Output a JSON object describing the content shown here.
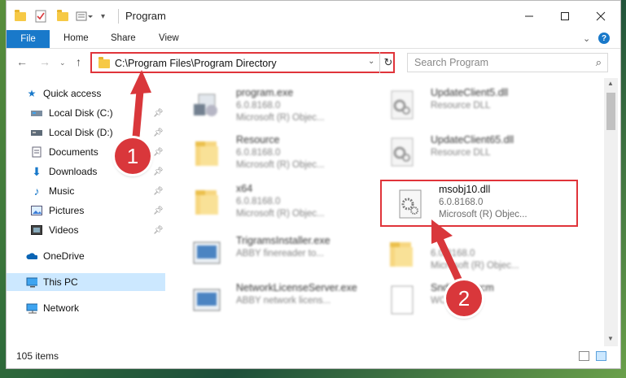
{
  "window": {
    "title": "Program",
    "minimize_icon": "minimize-icon",
    "maximize_icon": "maximize-icon",
    "close_icon": "close-icon"
  },
  "ribbon": {
    "tabs": [
      "File",
      "Home",
      "Share",
      "View"
    ],
    "help_label": "?"
  },
  "navigation": {
    "address_path": "C:\\Program Files\\Program Directory",
    "search_placeholder": "Search Program"
  },
  "sidebar": {
    "items": [
      {
        "label": "Quick access",
        "icon": "star-icon"
      },
      {
        "label": "Local Disk (C:)",
        "icon": "drive-icon",
        "pinned": true
      },
      {
        "label": "Local Disk (D:)",
        "icon": "drive-icon",
        "pinned": true
      },
      {
        "label": "Documents",
        "icon": "documents-icon",
        "pinned": true
      },
      {
        "label": "Downloads",
        "icon": "download-icon",
        "pinned": true
      },
      {
        "label": "Music",
        "icon": "music-icon",
        "pinned": true
      },
      {
        "label": "Pictures",
        "icon": "pictures-icon",
        "pinned": true
      },
      {
        "label": "Videos",
        "icon": "videos-icon",
        "pinned": true
      },
      {
        "label": "OneDrive",
        "icon": "cloud-icon"
      },
      {
        "label": "This PC",
        "icon": "computer-icon",
        "selected": true
      },
      {
        "label": "Network",
        "icon": "network-icon"
      }
    ]
  },
  "files": [
    {
      "name": "program.exe",
      "line1": "6.0.8168.0",
      "line2": "Microsoft (R) Objec...",
      "icon": "exe-icon"
    },
    {
      "name": "UpdateClient5.dll",
      "line1": "Resource DLL",
      "line2": "",
      "icon": "dll-icon"
    },
    {
      "name": "Resource",
      "line1": "6.0.8168.0",
      "line2": "Microsoft (R) Objec...",
      "icon": "folder-icon"
    },
    {
      "name": "UpdateClient65.dll",
      "line1": "Resource DLL",
      "line2": "",
      "icon": "dll-icon"
    },
    {
      "name": "x64",
      "line1": "6.0.8168.0",
      "line2": "Microsoft (R) Objec...",
      "icon": "folder-icon"
    },
    {
      "name": "msobj10.dll",
      "line1": "6.0.8168.0",
      "line2": "Microsoft (R) Objec...",
      "icon": "dll-icon"
    },
    {
      "name": "TrigramsInstaller.exe",
      "line1": "ABBY finereader to...",
      "line2": "",
      "icon": "installer-icon"
    },
    {
      "name": "",
      "line1": "6.0.8168.0",
      "line2": "Microsoft (R) Objec...",
      "icon": "folder-icon"
    },
    {
      "name": "NetworkLicenseServer.exe",
      "line1": "ABBY network licens...",
      "line2": "",
      "icon": "installer-icon"
    },
    {
      "name": "Snd1…5.wcm",
      "line1": "WCM",
      "line2": "",
      "icon": "file-icon"
    }
  ],
  "status": {
    "item_count": "105 items"
  },
  "annotations": {
    "step1": "1",
    "step2": "2",
    "accent": "#d9373b"
  }
}
